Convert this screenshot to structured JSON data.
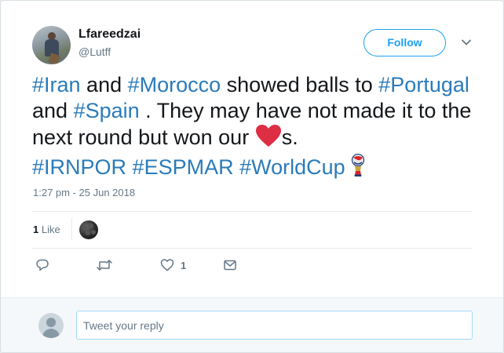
{
  "user": {
    "name": "Lfareedzai",
    "handle": "@Lutff"
  },
  "header": {
    "follow_label": "Follow"
  },
  "tweet": {
    "segments": [
      {
        "text": "#Iran",
        "type": "hashtag"
      },
      {
        "text": " and ",
        "type": "text"
      },
      {
        "text": "#Morocco",
        "type": "hashtag"
      },
      {
        "text": " showed balls to ",
        "type": "text"
      },
      {
        "text": "#Portugal",
        "type": "hashtag"
      },
      {
        "text": " and ",
        "type": "text"
      },
      {
        "text": "#Spain",
        "type": "hashtag"
      },
      {
        "text": " . They may have not made it to the next round but won our ",
        "type": "text"
      },
      {
        "text": "s.",
        "type": "text"
      },
      {
        "text": "#IRNPOR",
        "type": "hashtag"
      },
      {
        "text": " ",
        "type": "text"
      },
      {
        "text": "#ESPMAR",
        "type": "hashtag"
      },
      {
        "text": " ",
        "type": "text"
      },
      {
        "text": "#WorldCup",
        "type": "hashtag"
      }
    ],
    "timestamp": "1:27 pm - 25 Jun 2018",
    "likes_count": "1",
    "likes_label": "Like"
  },
  "actions": {
    "like_count": "1"
  },
  "reply": {
    "placeholder": "Tweet your reply"
  },
  "colors": {
    "accent": "#1da1f2",
    "hashtag": "#2b7bb9",
    "heart": "#dd2e44",
    "secondary_text": "#657786"
  },
  "icons": [
    "avatar",
    "chevron-down-icon",
    "heart-emoji",
    "worldcup-trophy-emoji",
    "reply-icon",
    "retweet-icon",
    "like-icon",
    "direct-message-icon"
  ]
}
